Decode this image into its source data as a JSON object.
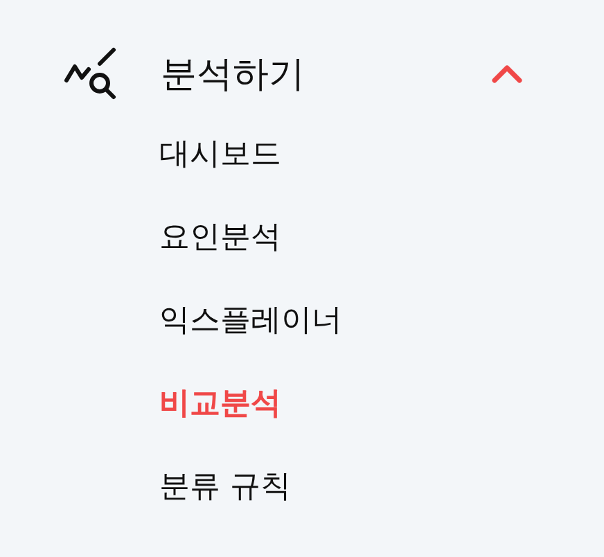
{
  "menu_section": {
    "title": "분석하기",
    "expanded": true,
    "items": [
      {
        "label": "대시보드",
        "selected": false
      },
      {
        "label": "요인분석",
        "selected": false
      },
      {
        "label": "익스플레이너",
        "selected": false
      },
      {
        "label": "비교분석",
        "selected": true
      },
      {
        "label": "분류 규칙",
        "selected": false
      }
    ]
  }
}
